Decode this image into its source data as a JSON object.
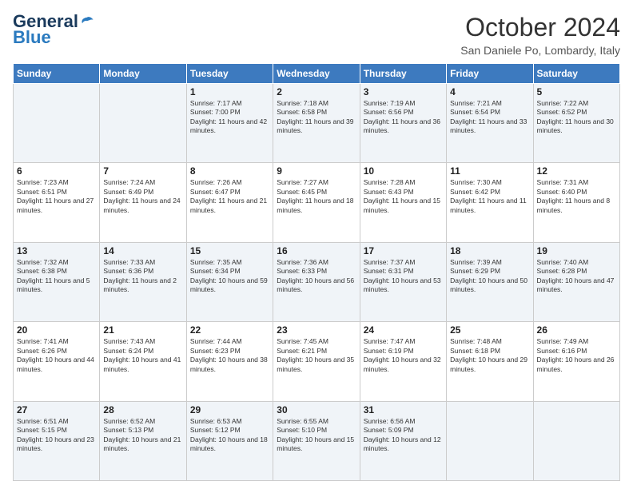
{
  "header": {
    "logo": {
      "general": "General",
      "blue": "Blue"
    },
    "title": "October 2024",
    "location": "San Daniele Po, Lombardy, Italy"
  },
  "days_of_week": [
    "Sunday",
    "Monday",
    "Tuesday",
    "Wednesday",
    "Thursday",
    "Friday",
    "Saturday"
  ],
  "weeks": [
    [
      {
        "day": "",
        "info": ""
      },
      {
        "day": "",
        "info": ""
      },
      {
        "day": "1",
        "info": "Sunrise: 7:17 AM\nSunset: 7:00 PM\nDaylight: 11 hours and 42 minutes."
      },
      {
        "day": "2",
        "info": "Sunrise: 7:18 AM\nSunset: 6:58 PM\nDaylight: 11 hours and 39 minutes."
      },
      {
        "day": "3",
        "info": "Sunrise: 7:19 AM\nSunset: 6:56 PM\nDaylight: 11 hours and 36 minutes."
      },
      {
        "day": "4",
        "info": "Sunrise: 7:21 AM\nSunset: 6:54 PM\nDaylight: 11 hours and 33 minutes."
      },
      {
        "day": "5",
        "info": "Sunrise: 7:22 AM\nSunset: 6:52 PM\nDaylight: 11 hours and 30 minutes."
      }
    ],
    [
      {
        "day": "6",
        "info": "Sunrise: 7:23 AM\nSunset: 6:51 PM\nDaylight: 11 hours and 27 minutes."
      },
      {
        "day": "7",
        "info": "Sunrise: 7:24 AM\nSunset: 6:49 PM\nDaylight: 11 hours and 24 minutes."
      },
      {
        "day": "8",
        "info": "Sunrise: 7:26 AM\nSunset: 6:47 PM\nDaylight: 11 hours and 21 minutes."
      },
      {
        "day": "9",
        "info": "Sunrise: 7:27 AM\nSunset: 6:45 PM\nDaylight: 11 hours and 18 minutes."
      },
      {
        "day": "10",
        "info": "Sunrise: 7:28 AM\nSunset: 6:43 PM\nDaylight: 11 hours and 15 minutes."
      },
      {
        "day": "11",
        "info": "Sunrise: 7:30 AM\nSunset: 6:42 PM\nDaylight: 11 hours and 11 minutes."
      },
      {
        "day": "12",
        "info": "Sunrise: 7:31 AM\nSunset: 6:40 PM\nDaylight: 11 hours and 8 minutes."
      }
    ],
    [
      {
        "day": "13",
        "info": "Sunrise: 7:32 AM\nSunset: 6:38 PM\nDaylight: 11 hours and 5 minutes."
      },
      {
        "day": "14",
        "info": "Sunrise: 7:33 AM\nSunset: 6:36 PM\nDaylight: 11 hours and 2 minutes."
      },
      {
        "day": "15",
        "info": "Sunrise: 7:35 AM\nSunset: 6:34 PM\nDaylight: 10 hours and 59 minutes."
      },
      {
        "day": "16",
        "info": "Sunrise: 7:36 AM\nSunset: 6:33 PM\nDaylight: 10 hours and 56 minutes."
      },
      {
        "day": "17",
        "info": "Sunrise: 7:37 AM\nSunset: 6:31 PM\nDaylight: 10 hours and 53 minutes."
      },
      {
        "day": "18",
        "info": "Sunrise: 7:39 AM\nSunset: 6:29 PM\nDaylight: 10 hours and 50 minutes."
      },
      {
        "day": "19",
        "info": "Sunrise: 7:40 AM\nSunset: 6:28 PM\nDaylight: 10 hours and 47 minutes."
      }
    ],
    [
      {
        "day": "20",
        "info": "Sunrise: 7:41 AM\nSunset: 6:26 PM\nDaylight: 10 hours and 44 minutes."
      },
      {
        "day": "21",
        "info": "Sunrise: 7:43 AM\nSunset: 6:24 PM\nDaylight: 10 hours and 41 minutes."
      },
      {
        "day": "22",
        "info": "Sunrise: 7:44 AM\nSunset: 6:23 PM\nDaylight: 10 hours and 38 minutes."
      },
      {
        "day": "23",
        "info": "Sunrise: 7:45 AM\nSunset: 6:21 PM\nDaylight: 10 hours and 35 minutes."
      },
      {
        "day": "24",
        "info": "Sunrise: 7:47 AM\nSunset: 6:19 PM\nDaylight: 10 hours and 32 minutes."
      },
      {
        "day": "25",
        "info": "Sunrise: 7:48 AM\nSunset: 6:18 PM\nDaylight: 10 hours and 29 minutes."
      },
      {
        "day": "26",
        "info": "Sunrise: 7:49 AM\nSunset: 6:16 PM\nDaylight: 10 hours and 26 minutes."
      }
    ],
    [
      {
        "day": "27",
        "info": "Sunrise: 6:51 AM\nSunset: 5:15 PM\nDaylight: 10 hours and 23 minutes."
      },
      {
        "day": "28",
        "info": "Sunrise: 6:52 AM\nSunset: 5:13 PM\nDaylight: 10 hours and 21 minutes."
      },
      {
        "day": "29",
        "info": "Sunrise: 6:53 AM\nSunset: 5:12 PM\nDaylight: 10 hours and 18 minutes."
      },
      {
        "day": "30",
        "info": "Sunrise: 6:55 AM\nSunset: 5:10 PM\nDaylight: 10 hours and 15 minutes."
      },
      {
        "day": "31",
        "info": "Sunrise: 6:56 AM\nSunset: 5:09 PM\nDaylight: 10 hours and 12 minutes."
      },
      {
        "day": "",
        "info": ""
      },
      {
        "day": "",
        "info": ""
      }
    ]
  ]
}
